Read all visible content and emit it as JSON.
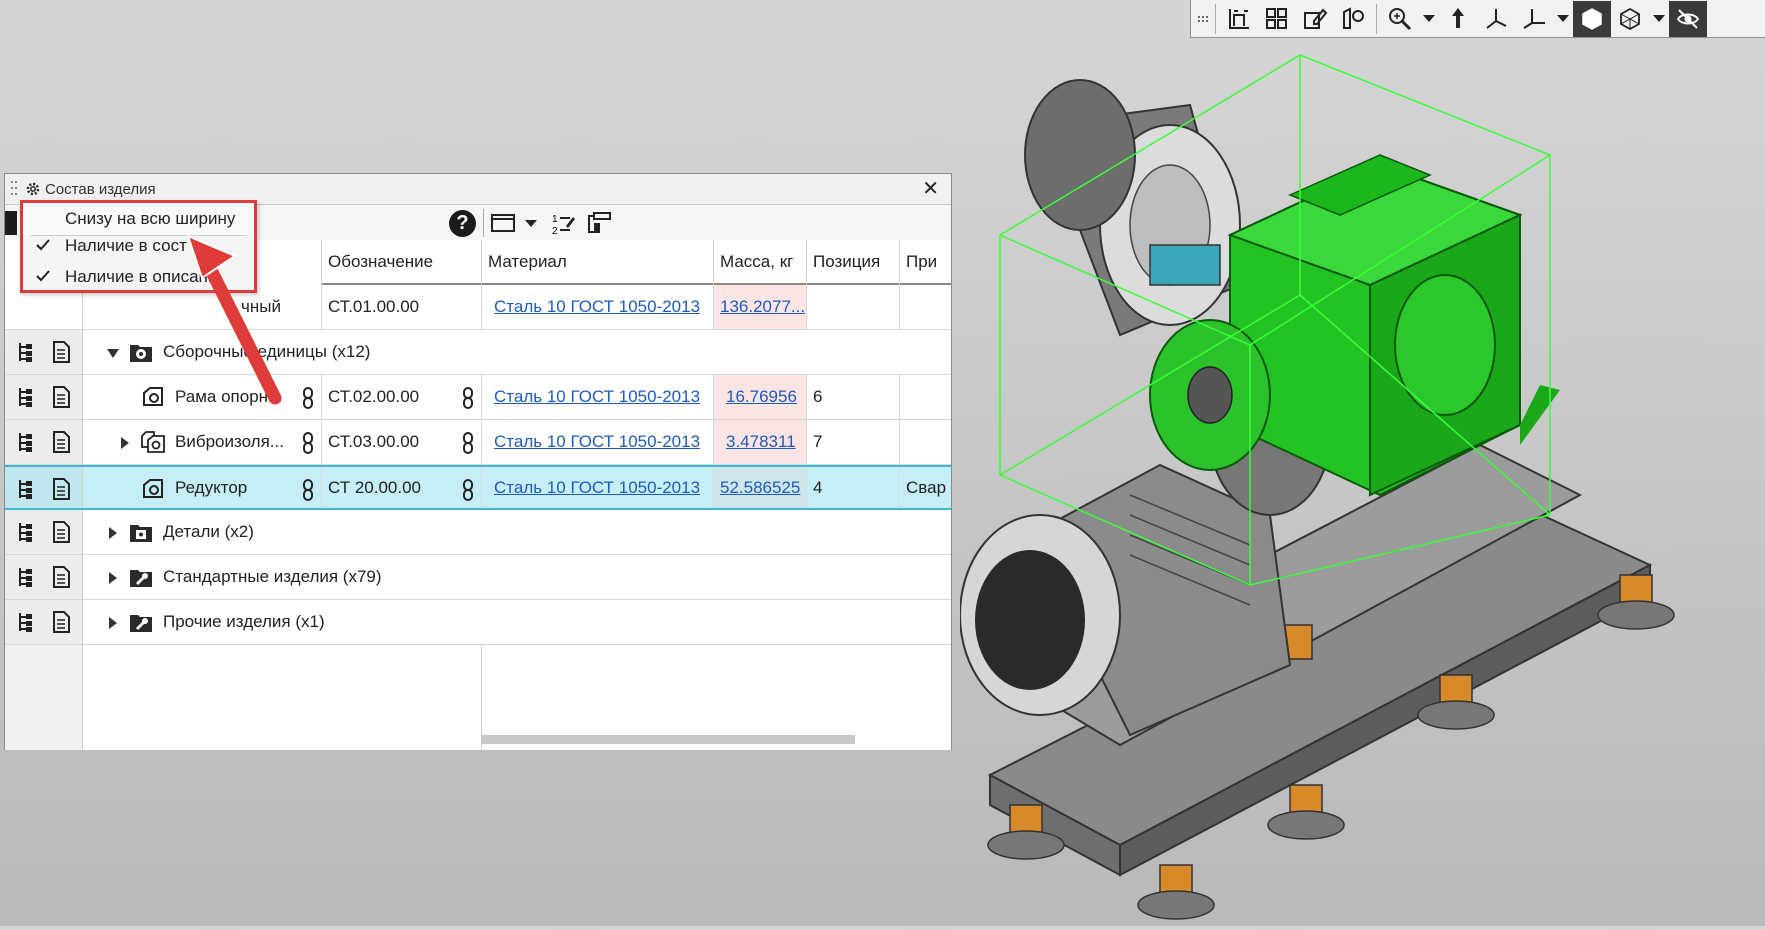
{
  "toolbar": {
    "buttons": [
      {
        "name": "sketch-icon"
      },
      {
        "name": "components-icon"
      },
      {
        "name": "edit-icon"
      },
      {
        "name": "doc-edit-icon"
      },
      {
        "name": "zoom-icon"
      },
      {
        "name": "orient-icon"
      },
      {
        "name": "axes-icon"
      },
      {
        "name": "triad-icon"
      },
      {
        "name": "shaded-icon"
      },
      {
        "name": "wireframe-icon"
      },
      {
        "name": "hide-icon"
      }
    ]
  },
  "panel": {
    "title": "Состав изделия",
    "columns": [
      "Обозначение",
      "Материал",
      "Масса, кг",
      "Позиция",
      "При"
    ],
    "rows": [
      {
        "name": "чный",
        "designation": "СТ.01.00.00",
        "material": "Сталь 10 ГОСТ 1050-2013",
        "mass": "136.2077...",
        "position": "",
        "note": ""
      },
      {
        "name": "Сборочные единицы (x12)",
        "group": true
      },
      {
        "name": "Рама опорн...",
        "designation": "СТ.02.00.00",
        "material": "Сталь 10 ГОСТ 1050-2013",
        "mass": "16.76956",
        "position": "6",
        "note": ""
      },
      {
        "name": "Виброизоля...",
        "designation": "СТ.03.00.00",
        "material": "Сталь 10 ГОСТ 1050-2013",
        "mass": "3.478311",
        "position": "7",
        "note": ""
      },
      {
        "name": "Редуктор",
        "designation": "СТ 20.00.00",
        "material": "Сталь 10 ГОСТ 1050-2013",
        "mass": "52.586525",
        "position": "4",
        "note": "Свар",
        "selected": true
      },
      {
        "name": "Детали (x2)",
        "group": true
      },
      {
        "name": "Стандартные изделия (x79)",
        "group": true
      },
      {
        "name": "Прочие изделия (x1)",
        "group": true
      }
    ]
  },
  "context_menu": {
    "items": [
      {
        "label": "Снизу на всю ширину",
        "checked": false
      },
      {
        "label": "Наличие в сост",
        "checked": true
      },
      {
        "label": "Наличие в описани",
        "checked": true
      }
    ]
  },
  "colors": {
    "selection": "#c6eef6",
    "accent_red": "#e03b3b",
    "model_green": "#22c322",
    "link": "#1f5bbd"
  }
}
